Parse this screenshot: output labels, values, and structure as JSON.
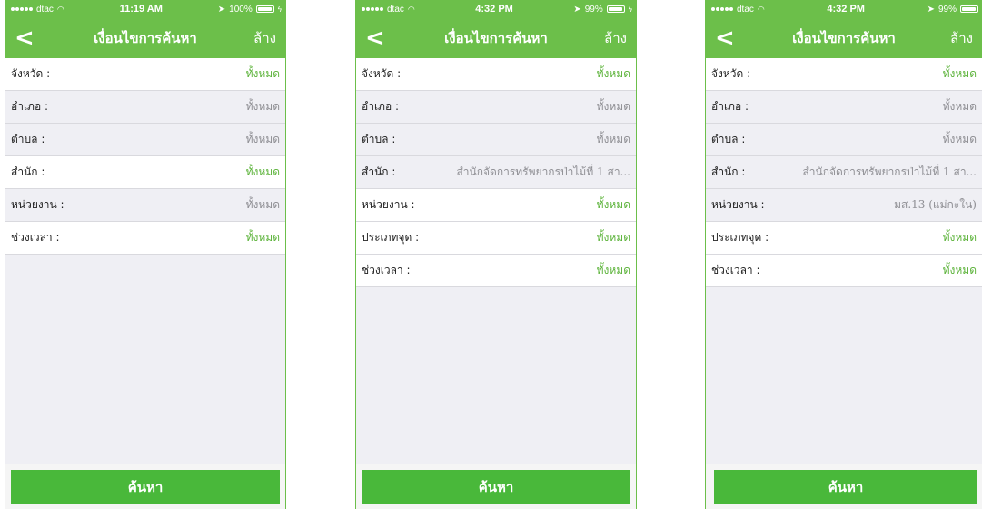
{
  "colors": {
    "accent": "#6cbf4a",
    "button": "#49b83a",
    "value_green": "#5cb33a",
    "value_gray": "#8e8e93",
    "background": "#efeff4"
  },
  "icons": {
    "back": "chevron-left-icon",
    "signal": "signal-icon",
    "wifi": "wifi-icon",
    "battery": "battery-icon"
  },
  "screens": [
    {
      "status": {
        "carrier": "dtac",
        "time": "11:19 AM",
        "battery": "100%"
      },
      "nav": {
        "back": "<",
        "title": "เงื่อนไขการค้นหา",
        "clear": "ล้าง"
      },
      "rows": [
        {
          "label": "จังหวัด :",
          "value": "ทั้งหมด"
        },
        {
          "label": "อำเภอ :",
          "value": "ทั้งหมด"
        },
        {
          "label": "ตำบล :",
          "value": "ทั้งหมด"
        },
        {
          "label": "สำนัก :",
          "value": "ทั้งหมด"
        },
        {
          "label": "หน่วยงาน :",
          "value": "ทั้งหมด"
        },
        {
          "label": "ช่วงเวลา :",
          "value": "ทั้งหมด"
        }
      ],
      "search_button": "ค้นหา"
    },
    {
      "status": {
        "carrier": "dtac",
        "time": "4:32 PM",
        "battery": "99%"
      },
      "nav": {
        "back": "<",
        "title": "เงื่อนไขการค้นหา",
        "clear": "ล้าง"
      },
      "rows": [
        {
          "label": "จังหวัด :",
          "value": "ทั้งหมด"
        },
        {
          "label": "อำเภอ :",
          "value": "ทั้งหมด"
        },
        {
          "label": "ตำบล :",
          "value": "ทั้งหมด"
        },
        {
          "label": "สำนัก :",
          "value": "สำนักจัดการทรัพยากรป่าไม้ที่ 1 สา..."
        },
        {
          "label": "หน่วยงาน :",
          "value": "ทั้งหมด"
        },
        {
          "label": "ประเภทจุด :",
          "value": "ทั้งหมด"
        },
        {
          "label": "ช่วงเวลา :",
          "value": "ทั้งหมด"
        }
      ],
      "search_button": "ค้นหา"
    },
    {
      "status": {
        "carrier": "dtac",
        "time": "4:32 PM",
        "battery": "99%"
      },
      "nav": {
        "back": "<",
        "title": "เงื่อนไขการค้นหา",
        "clear": "ล้าง"
      },
      "rows": [
        {
          "label": "จังหวัด :",
          "value": "ทั้งหมด"
        },
        {
          "label": "อำเภอ :",
          "value": "ทั้งหมด"
        },
        {
          "label": "ตำบล :",
          "value": "ทั้งหมด"
        },
        {
          "label": "สำนัก :",
          "value": "สำนักจัดการทรัพยากรป่าไม้ที่ 1 สา..."
        },
        {
          "label": "หน่วยงาน :",
          "value": "มส.13 (แม่กะใน)"
        },
        {
          "label": "ประเภทจุด :",
          "value": "ทั้งหมด"
        },
        {
          "label": "ช่วงเวลา :",
          "value": "ทั้งหมด"
        }
      ],
      "search_button": "ค้นหา"
    }
  ]
}
